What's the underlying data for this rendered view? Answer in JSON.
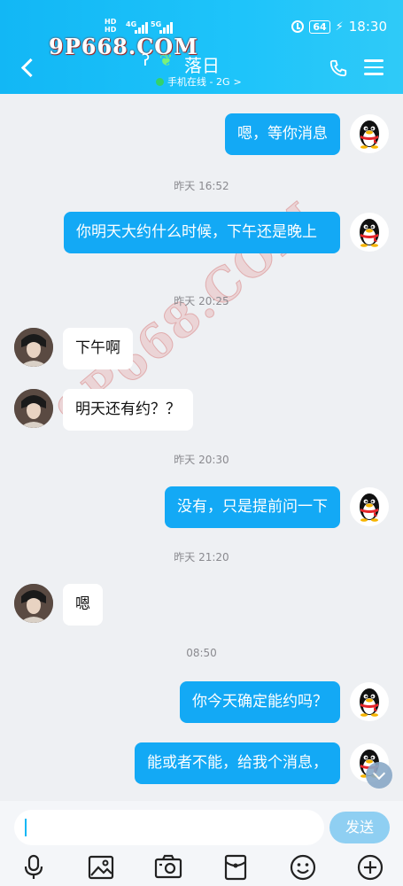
{
  "status_bar": {
    "signal_left_top": "HD",
    "signal_left_bottom": "HD",
    "net_4g": "4G",
    "net_5g": "5G",
    "battery": "64",
    "time": "18:30"
  },
  "watermark": {
    "top_text": "9P668.COM",
    "diagonal_text": "9P668.COM"
  },
  "header": {
    "title": "落日",
    "subtitle": "手机在线 - 2G",
    "subtitle_chevron": ">"
  },
  "messages": [
    {
      "side": "me",
      "text": "嗯，等你消息"
    },
    {
      "time": "昨天 16:52"
    },
    {
      "side": "me",
      "text": "你明天大约什么时候，下午还是晚上"
    },
    {
      "time": "昨天 20:25"
    },
    {
      "side": "them",
      "text": "下午啊"
    },
    {
      "side": "them",
      "text": "明天还有约？？"
    },
    {
      "time": "昨天 20:30"
    },
    {
      "side": "me",
      "text": "没有，只是提前问一下"
    },
    {
      "time": "昨天 21:20"
    },
    {
      "side": "them",
      "text": "嗯"
    },
    {
      "time": "08:50"
    },
    {
      "side": "me",
      "text": "你今天确定能约吗？"
    },
    {
      "side": "me",
      "text": "能或者不能，给我个消息，"
    }
  ],
  "input": {
    "send_label": "发送"
  },
  "toolbar_icons": [
    "mic-icon",
    "image-icon",
    "camera-icon",
    "red-packet-icon",
    "emoji-icon",
    "plus-icon"
  ],
  "colors": {
    "header": "#12b7f5",
    "my_bubble": "#13a9f5",
    "their_bubble": "#ffffff",
    "send_button": "#8fcff2"
  }
}
